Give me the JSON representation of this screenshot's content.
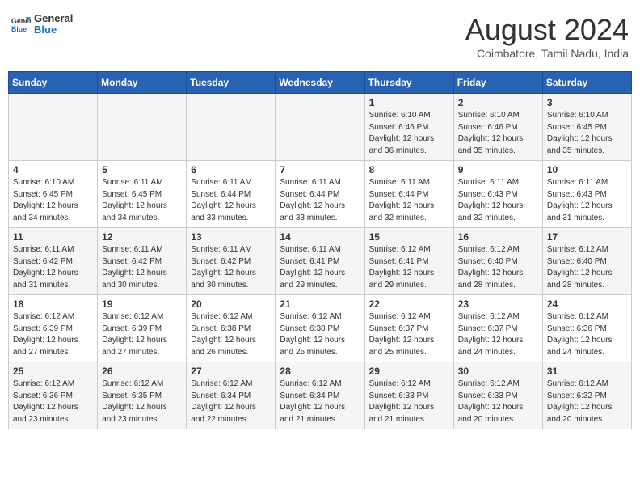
{
  "header": {
    "logo": {
      "general": "General",
      "blue": "Blue"
    },
    "title": "August 2024",
    "subtitle": "Coimbatore, Tamil Nadu, India"
  },
  "calendar": {
    "days_of_week": [
      "Sunday",
      "Monday",
      "Tuesday",
      "Wednesday",
      "Thursday",
      "Friday",
      "Saturday"
    ],
    "weeks": [
      [
        {
          "day": "",
          "info": ""
        },
        {
          "day": "",
          "info": ""
        },
        {
          "day": "",
          "info": ""
        },
        {
          "day": "",
          "info": ""
        },
        {
          "day": "1",
          "info": "Sunrise: 6:10 AM\nSunset: 6:46 PM\nDaylight: 12 hours\nand 36 minutes."
        },
        {
          "day": "2",
          "info": "Sunrise: 6:10 AM\nSunset: 6:46 PM\nDaylight: 12 hours\nand 35 minutes."
        },
        {
          "day": "3",
          "info": "Sunrise: 6:10 AM\nSunset: 6:45 PM\nDaylight: 12 hours\nand 35 minutes."
        }
      ],
      [
        {
          "day": "4",
          "info": "Sunrise: 6:10 AM\nSunset: 6:45 PM\nDaylight: 12 hours\nand 34 minutes."
        },
        {
          "day": "5",
          "info": "Sunrise: 6:11 AM\nSunset: 6:45 PM\nDaylight: 12 hours\nand 34 minutes."
        },
        {
          "day": "6",
          "info": "Sunrise: 6:11 AM\nSunset: 6:44 PM\nDaylight: 12 hours\nand 33 minutes."
        },
        {
          "day": "7",
          "info": "Sunrise: 6:11 AM\nSunset: 6:44 PM\nDaylight: 12 hours\nand 33 minutes."
        },
        {
          "day": "8",
          "info": "Sunrise: 6:11 AM\nSunset: 6:44 PM\nDaylight: 12 hours\nand 32 minutes."
        },
        {
          "day": "9",
          "info": "Sunrise: 6:11 AM\nSunset: 6:43 PM\nDaylight: 12 hours\nand 32 minutes."
        },
        {
          "day": "10",
          "info": "Sunrise: 6:11 AM\nSunset: 6:43 PM\nDaylight: 12 hours\nand 31 minutes."
        }
      ],
      [
        {
          "day": "11",
          "info": "Sunrise: 6:11 AM\nSunset: 6:42 PM\nDaylight: 12 hours\nand 31 minutes."
        },
        {
          "day": "12",
          "info": "Sunrise: 6:11 AM\nSunset: 6:42 PM\nDaylight: 12 hours\nand 30 minutes."
        },
        {
          "day": "13",
          "info": "Sunrise: 6:11 AM\nSunset: 6:42 PM\nDaylight: 12 hours\nand 30 minutes."
        },
        {
          "day": "14",
          "info": "Sunrise: 6:11 AM\nSunset: 6:41 PM\nDaylight: 12 hours\nand 29 minutes."
        },
        {
          "day": "15",
          "info": "Sunrise: 6:12 AM\nSunset: 6:41 PM\nDaylight: 12 hours\nand 29 minutes."
        },
        {
          "day": "16",
          "info": "Sunrise: 6:12 AM\nSunset: 6:40 PM\nDaylight: 12 hours\nand 28 minutes."
        },
        {
          "day": "17",
          "info": "Sunrise: 6:12 AM\nSunset: 6:40 PM\nDaylight: 12 hours\nand 28 minutes."
        }
      ],
      [
        {
          "day": "18",
          "info": "Sunrise: 6:12 AM\nSunset: 6:39 PM\nDaylight: 12 hours\nand 27 minutes."
        },
        {
          "day": "19",
          "info": "Sunrise: 6:12 AM\nSunset: 6:39 PM\nDaylight: 12 hours\nand 27 minutes."
        },
        {
          "day": "20",
          "info": "Sunrise: 6:12 AM\nSunset: 6:38 PM\nDaylight: 12 hours\nand 26 minutes."
        },
        {
          "day": "21",
          "info": "Sunrise: 6:12 AM\nSunset: 6:38 PM\nDaylight: 12 hours\nand 25 minutes."
        },
        {
          "day": "22",
          "info": "Sunrise: 6:12 AM\nSunset: 6:37 PM\nDaylight: 12 hours\nand 25 minutes."
        },
        {
          "day": "23",
          "info": "Sunrise: 6:12 AM\nSunset: 6:37 PM\nDaylight: 12 hours\nand 24 minutes."
        },
        {
          "day": "24",
          "info": "Sunrise: 6:12 AM\nSunset: 6:36 PM\nDaylight: 12 hours\nand 24 minutes."
        }
      ],
      [
        {
          "day": "25",
          "info": "Sunrise: 6:12 AM\nSunset: 6:36 PM\nDaylight: 12 hours\nand 23 minutes."
        },
        {
          "day": "26",
          "info": "Sunrise: 6:12 AM\nSunset: 6:35 PM\nDaylight: 12 hours\nand 23 minutes."
        },
        {
          "day": "27",
          "info": "Sunrise: 6:12 AM\nSunset: 6:34 PM\nDaylight: 12 hours\nand 22 minutes."
        },
        {
          "day": "28",
          "info": "Sunrise: 6:12 AM\nSunset: 6:34 PM\nDaylight: 12 hours\nand 21 minutes."
        },
        {
          "day": "29",
          "info": "Sunrise: 6:12 AM\nSunset: 6:33 PM\nDaylight: 12 hours\nand 21 minutes."
        },
        {
          "day": "30",
          "info": "Sunrise: 6:12 AM\nSunset: 6:33 PM\nDaylight: 12 hours\nand 20 minutes."
        },
        {
          "day": "31",
          "info": "Sunrise: 6:12 AM\nSunset: 6:32 PM\nDaylight: 12 hours\nand 20 minutes."
        }
      ]
    ]
  }
}
